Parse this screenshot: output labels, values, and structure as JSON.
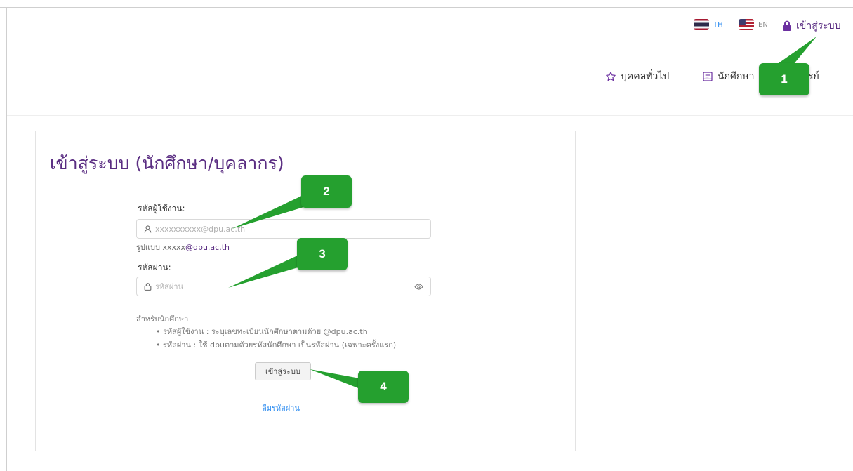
{
  "header": {
    "lang_th": "TH",
    "lang_en": "EN",
    "login_label": "เข้าสู่ระบบ"
  },
  "nav": {
    "general_label": "บุคคลทั่วไป",
    "student_label": "นักศึกษา",
    "teacher_label_visible": "จารย์"
  },
  "form": {
    "title": "เข้าสู่ระบบ (นักศึกษา/บุคลากร)",
    "username_label": "รหัสผู้ใช้งาน:",
    "username_placeholder": "xxxxxxxxxx@dpu.ac.th",
    "format_hint_prefix": "รูปแบบ xxxxx",
    "format_hint_domain": "@dpu.ac.th",
    "password_label": "รหัสผ่าน:",
    "password_placeholder": "รหัสผ่าน",
    "help_title": "สำหรับนักศึกษา",
    "help_line_1": "• รหัสผู้ใช้งาน : ระบุเลขทะเบียนนักศึกษาตามด้วย @dpu.ac.th",
    "help_line_2": "• รหัสผ่าน : ใช้ dpuตามด้วยรหัสนักศึกษา เป็นรหัสผ่าน (เฉพาะครั้งแรก)",
    "submit_label": "เข้าสู่ระบบ",
    "forgot_label": "ลืมรหัสผ่าน"
  },
  "callouts": {
    "one": "1",
    "two": "2",
    "three": "3",
    "four": "4"
  },
  "colors": {
    "brand_purple": "#5a2d82",
    "link_blue": "#2d8cf0",
    "callout_green": "#25a02f"
  },
  "icons": {
    "lock": "lock-icon",
    "star": "star-icon",
    "student": "id-card-icon",
    "user": "user-icon",
    "eye": "eye-icon"
  }
}
